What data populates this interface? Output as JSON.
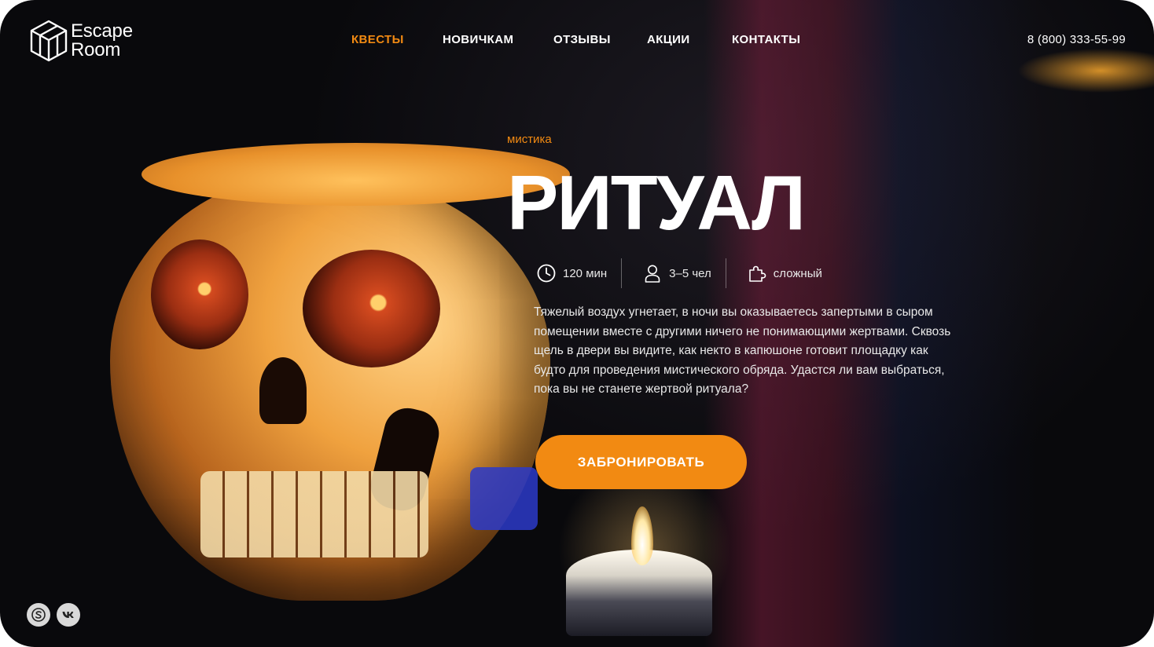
{
  "header": {
    "logo_line1": "Escape",
    "logo_line2": "Room",
    "nav": [
      {
        "label": "КВЕСТЫ",
        "active": true
      },
      {
        "label": "НОВИЧКАМ",
        "active": false
      },
      {
        "label": "ОТЗЫВЫ",
        "active": false
      },
      {
        "label": "АКЦИИ",
        "active": false
      },
      {
        "label": "КОНТАКТЫ",
        "active": false
      }
    ],
    "phone": "8 (800) 333-55-99"
  },
  "quest": {
    "genre": "мистика",
    "title": "РИТУАЛ",
    "duration": "120 мин",
    "players": "3–5 чел",
    "difficulty": "сложный",
    "description": "Тяжелый воздух угнетает, в ночи вы оказываетесь запертыми в сыром помещении вместе с другими ничего не понимающими жертвами. Сквозь щель в двери вы видите, как некто в капюшоне готовит площадку как будто для проведения мистического обряда. Удастся ли вам выбраться, пока вы не станете жертвой ритуала?",
    "book_button": "ЗАБРОНИРОВАТЬ"
  },
  "icons": {
    "duration": "clock-icon",
    "players": "person-icon",
    "difficulty": "puzzle-icon",
    "social1": "skype-icon",
    "social2": "vk-icon"
  },
  "colors": {
    "accent": "#F28A12",
    "text": "#FFFFFF",
    "background": "#0B0B0F"
  }
}
